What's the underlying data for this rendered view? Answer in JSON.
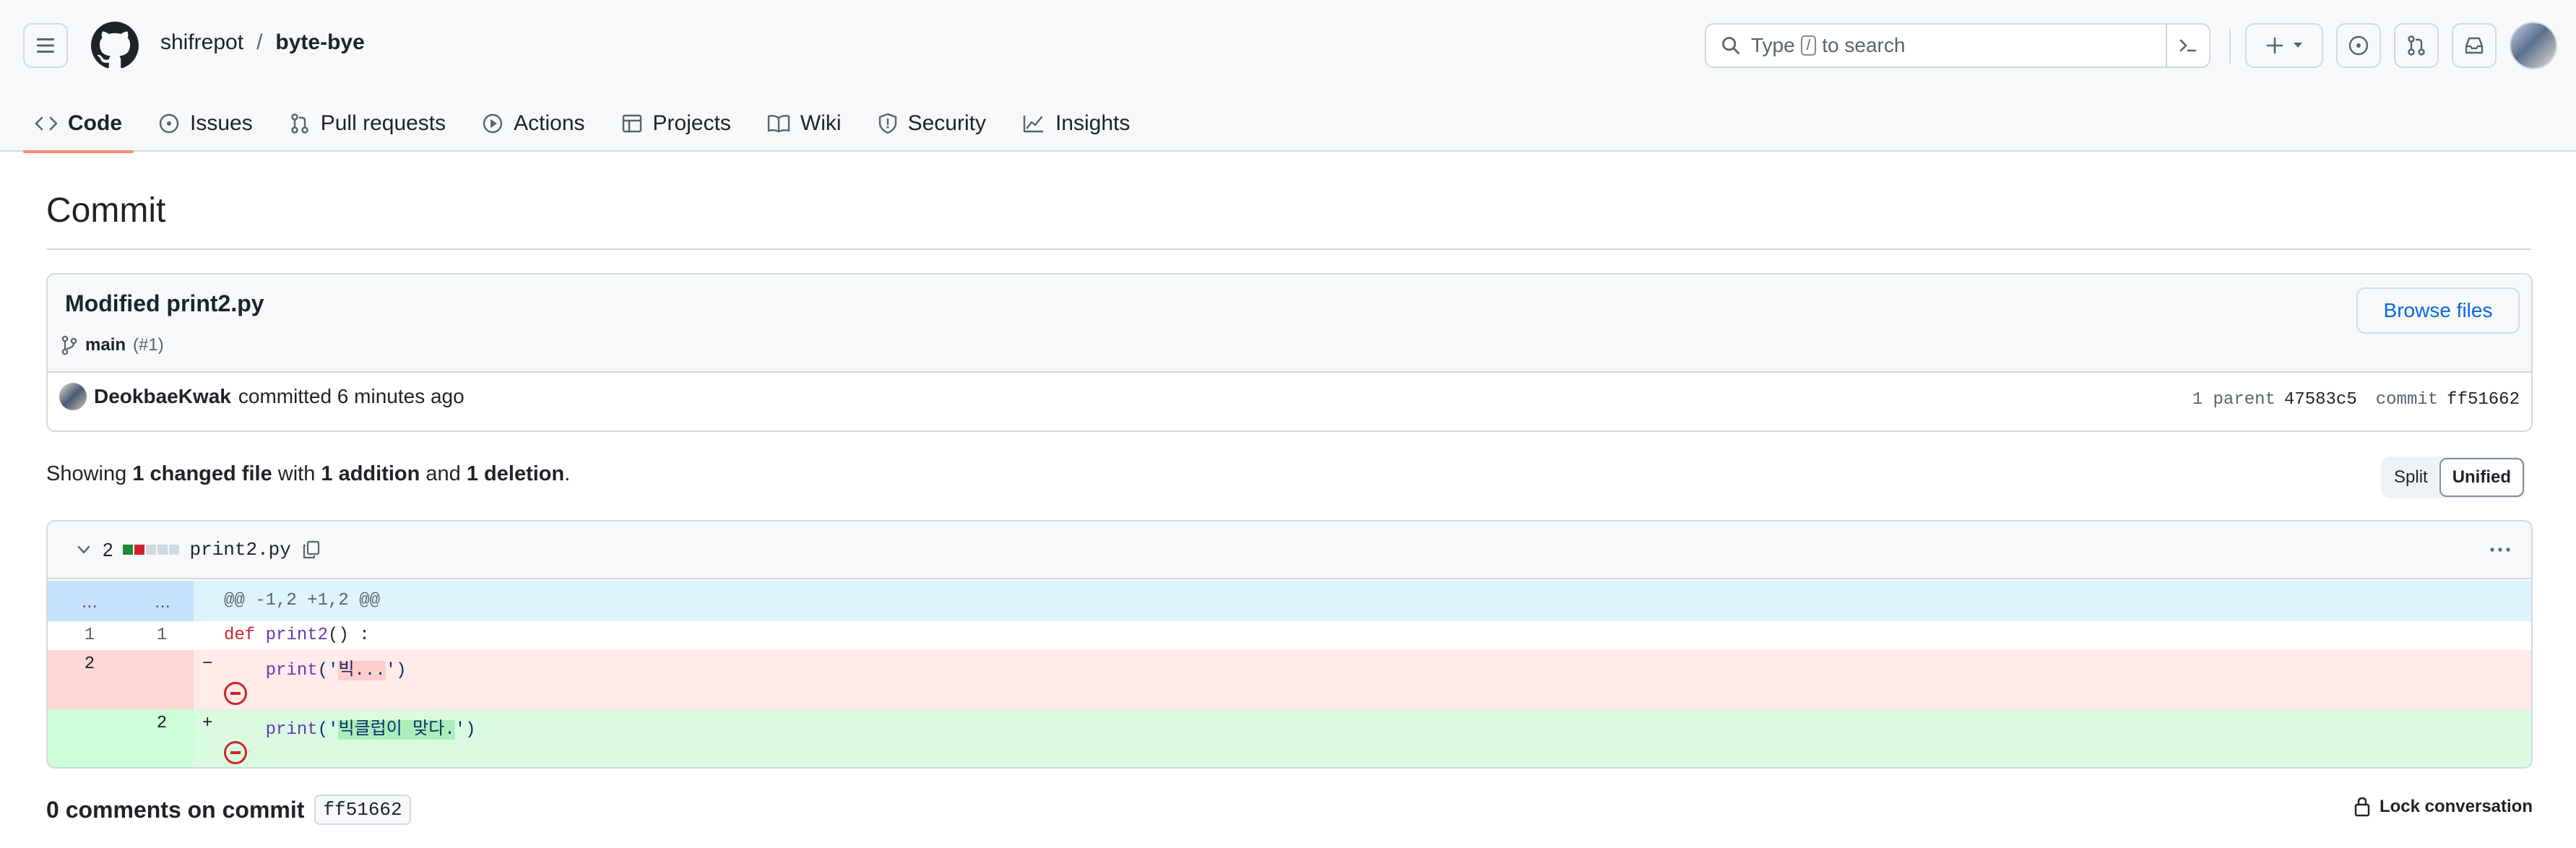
{
  "header": {
    "owner": "shifrepot",
    "separator": "/",
    "repo": "byte-bye",
    "search_prefix": "Type",
    "search_key": "/",
    "search_suffix": "to search"
  },
  "tabs": [
    {
      "label": "Code",
      "icon": "code-icon",
      "active": true
    },
    {
      "label": "Issues",
      "icon": "issue-icon"
    },
    {
      "label": "Pull requests",
      "icon": "pull-request-icon"
    },
    {
      "label": "Actions",
      "icon": "play-icon"
    },
    {
      "label": "Projects",
      "icon": "table-icon"
    },
    {
      "label": "Wiki",
      "icon": "book-icon"
    },
    {
      "label": "Security",
      "icon": "shield-icon"
    },
    {
      "label": "Insights",
      "icon": "graph-icon"
    }
  ],
  "page": {
    "title": "Commit"
  },
  "commit": {
    "message": "Modified print2.py",
    "branch": "main",
    "pr_ref": "(#1)",
    "browse_label": "Browse files",
    "author": "DeokbaeKwak",
    "committed_text": "committed 6 minutes ago",
    "parent_label": "1 parent",
    "parent_sha": "47583c5",
    "commit_label": "commit",
    "commit_sha": "ff51662"
  },
  "summary": {
    "showing": "Showing",
    "changed": "1 changed file",
    "with": "with",
    "additions": "1 addition",
    "and": "and",
    "deletions": "1 deletion",
    "period": "."
  },
  "view_toggle": {
    "split": "Split",
    "unified": "Unified",
    "selected": "Unified"
  },
  "file": {
    "changes": "2",
    "name": "print2.py",
    "hunk_gutter": "...",
    "hunk_header": "@@ -1,2 +1,2 @@",
    "lines": [
      {
        "old": "1",
        "new": "1",
        "marker": "",
        "kw": "def",
        "fn": "print2",
        "rest": "() :"
      },
      {
        "old": "2",
        "new": "",
        "marker": "−",
        "fn": "print",
        "open": "('",
        "hl": "빅...",
        "close": "')"
      },
      {
        "old": "",
        "new": "2",
        "marker": "+",
        "fn": "print",
        "open": "('",
        "hl": "빅클럽이 맞다.",
        "close": "')"
      }
    ]
  },
  "comments": {
    "text": "0 comments on commit",
    "sha": "ff51662",
    "lock_label": "Lock conversation"
  },
  "colors": {
    "accent": "#fd8c73",
    "link": "#0969da",
    "added": "#1f883d",
    "deleted": "#cf222e"
  }
}
